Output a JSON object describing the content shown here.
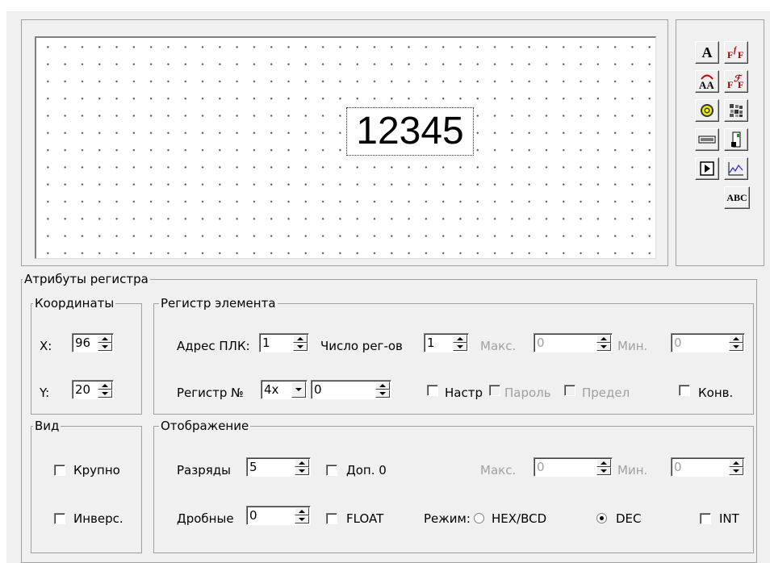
{
  "preview": {
    "number": "12345"
  },
  "toolbox": {
    "icons": [
      "font-icon",
      "font-style-icon",
      "font-rotate-icon",
      "font-effect-icon",
      "target-icon",
      "pattern-icon",
      "field-icon",
      "door-icon",
      "play-icon",
      "chart-icon",
      "abc-icon"
    ],
    "abc_label": "ABC",
    "a_label": "A"
  },
  "attributes": {
    "legend": "Атрибуты регистра",
    "coords": {
      "legend": "Координаты",
      "x_label": "X:",
      "x_value": "96",
      "y_label": "Y:",
      "y_value": "20"
    },
    "register": {
      "legend": "Регистр элемента",
      "plc_address_label": "Адрес ПЛК:",
      "plc_address_value": "1",
      "reg_count_label": "Число рег-ов",
      "reg_count_value": "1",
      "max_label": "Макс.",
      "max_value": "0",
      "min_label": "Мин.",
      "min_value": "0",
      "reg_no_label": "Регистр №",
      "reg_type_value": "4x",
      "reg_no_value": "0",
      "setup_label": "Настр",
      "password_label": "Пароль",
      "limit_label": "Предел",
      "conv_label": "Конв."
    },
    "view": {
      "legend": "Вид",
      "large_label": "Крупно",
      "inverse_label": "Инверс."
    },
    "display": {
      "legend": "Отображение",
      "digits_label": "Разряды",
      "digits_value": "5",
      "leading_zero_label": "Доп. 0",
      "max_label": "Макс.",
      "max_value": "0",
      "min_label": "Мин.",
      "min_value": "0",
      "fraction_label": "Дробные",
      "fraction_value": "0",
      "float_label": "FLOAT",
      "mode_label": "Режим:",
      "hex_label": "HEX/BCD",
      "dec_label": "DEC",
      "mode_selected": "DEC",
      "int_label": "INT"
    }
  }
}
